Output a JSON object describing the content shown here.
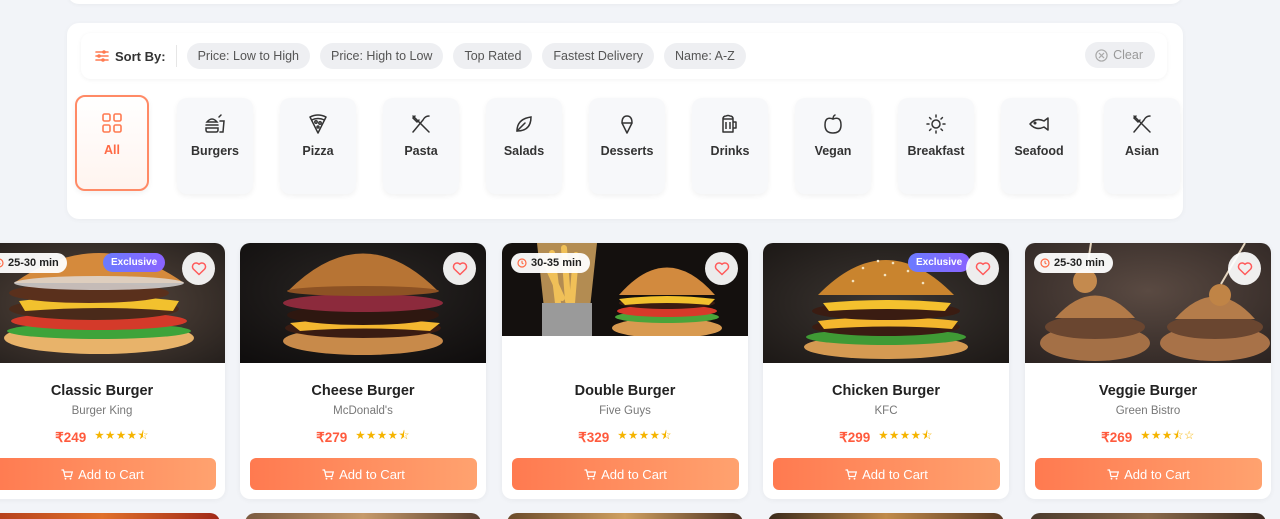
{
  "sort": {
    "label": "Sort By:",
    "options": [
      "Price: Low to High",
      "Price: High to Low",
      "Top Rated",
      "Fastest Delivery",
      "Name: A-Z"
    ],
    "clear_label": "Clear"
  },
  "categories": [
    {
      "label": "All",
      "icon": "grid-icon",
      "active": true
    },
    {
      "label": "Burgers",
      "icon": "burger-icon"
    },
    {
      "label": "Pizza",
      "icon": "pizza-icon"
    },
    {
      "label": "Pasta",
      "icon": "utensils-icon"
    },
    {
      "label": "Salads",
      "icon": "leaf-icon"
    },
    {
      "label": "Desserts",
      "icon": "ice-cream-icon"
    },
    {
      "label": "Drinks",
      "icon": "beer-mug-icon"
    },
    {
      "label": "Vegan",
      "icon": "apple-icon"
    },
    {
      "label": "Breakfast",
      "icon": "sun-icon"
    },
    {
      "label": "Seafood",
      "icon": "fish-icon"
    },
    {
      "label": "Asian",
      "icon": "utensils-icon"
    }
  ],
  "products": [
    {
      "name": "Classic Burger",
      "restaurant": "Burger King",
      "price": "₹249",
      "stars": "★★★★⯪",
      "rating": 4.5,
      "time": "25-30 min",
      "badge": "Exclusive",
      "add_label": "Add to Cart"
    },
    {
      "name": "Cheese Burger",
      "restaurant": "McDonald's",
      "price": "₹279",
      "stars": "★★★★⯪",
      "rating": 4.5,
      "time": "",
      "badge": "",
      "add_label": "Add to Cart"
    },
    {
      "name": "Double Burger",
      "restaurant": "Five Guys",
      "price": "₹329",
      "stars": "★★★★⯪",
      "rating": 4.5,
      "time": "30-35 min",
      "badge": "",
      "add_label": "Add to Cart"
    },
    {
      "name": "Chicken Burger",
      "restaurant": "KFC",
      "price": "₹299",
      "stars": "★★★★⯪",
      "rating": 4.5,
      "time": "",
      "badge": "Exclusive",
      "add_label": "Add to Cart"
    },
    {
      "name": "Veggie Burger",
      "restaurant": "Green Bistro",
      "price": "₹269",
      "stars": "★★★⯪☆",
      "rating": 3.5,
      "time": "25-30 min",
      "badge": "",
      "add_label": "Add to Cart"
    }
  ],
  "colors": {
    "accent": "#ff6a45",
    "price": "#ff5a3d",
    "star": "#f5b400",
    "badge": "#7a6cff"
  }
}
